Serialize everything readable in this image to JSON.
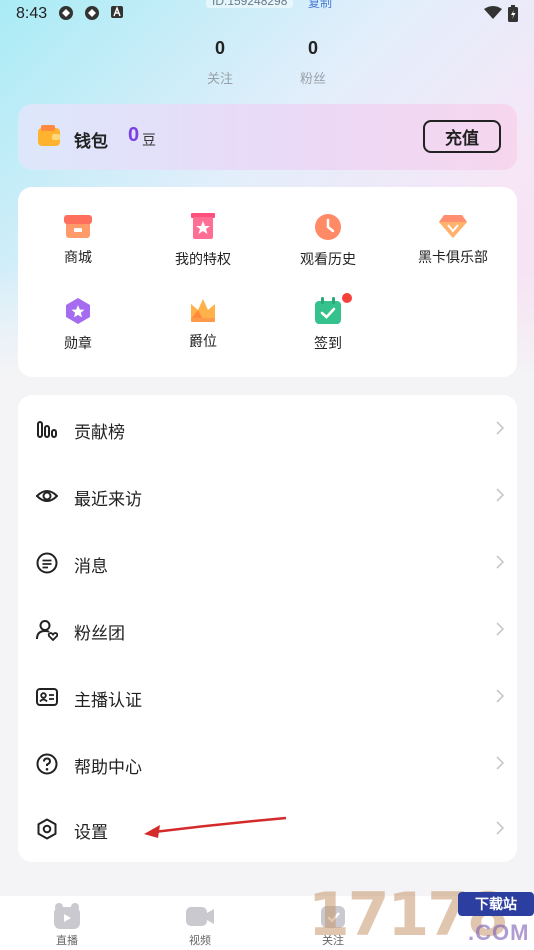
{
  "status_bar": {
    "time": "8:43",
    "id_text": "ID:159248298",
    "copy_label": "复制"
  },
  "stats": [
    {
      "value": "0",
      "label": "关注"
    },
    {
      "value": "0",
      "label": "粉丝"
    }
  ],
  "wallet": {
    "label": "钱包",
    "amount": "0",
    "unit": "豆",
    "recharge_label": "充值"
  },
  "features": [
    {
      "label": "商城",
      "icon": "shop-icon"
    },
    {
      "label": "我的特权",
      "icon": "privilege-icon"
    },
    {
      "label": "观看历史",
      "icon": "history-icon"
    },
    {
      "label": "黑卡俱乐部",
      "icon": "diamond-icon"
    },
    {
      "label": "勋章",
      "icon": "medal-icon"
    },
    {
      "label": "爵位",
      "icon": "crown-icon"
    },
    {
      "label": "签到",
      "icon": "checkin-icon",
      "badge": true
    }
  ],
  "menu": [
    {
      "label": "贡献榜",
      "icon": "bar-chart-icon"
    },
    {
      "label": "最近来访",
      "icon": "eye-icon"
    },
    {
      "label": "消息",
      "icon": "message-icon"
    },
    {
      "label": "粉丝团",
      "icon": "fans-icon"
    },
    {
      "label": "主播认证",
      "icon": "id-card-icon"
    },
    {
      "label": "帮助中心",
      "icon": "help-icon"
    },
    {
      "label": "设置",
      "icon": "settings-icon"
    }
  ],
  "tabs": [
    {
      "label": "直播",
      "icon": "live-icon"
    },
    {
      "label": "视频",
      "icon": "video-icon"
    },
    {
      "label": "关注",
      "icon": "follow-icon"
    }
  ],
  "watermark": {
    "digits": "17178",
    "badge": "下载站",
    "suffix": ".COM"
  },
  "colors": {
    "accent_purple": "#7b3fe4",
    "badge_red": "#f5413b",
    "annotation_arrow": "#d42a2a"
  }
}
